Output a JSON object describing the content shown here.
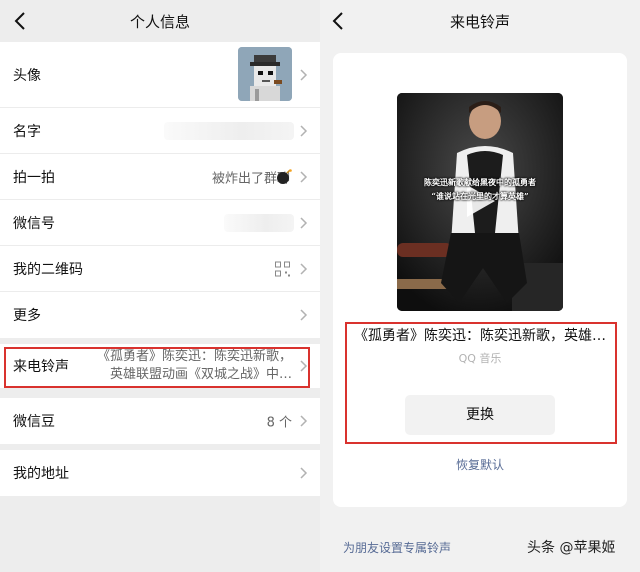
{
  "left": {
    "header": {
      "title": "个人信息"
    },
    "rows": {
      "avatar": {
        "label": "头像"
      },
      "name": {
        "label": "名字"
      },
      "pat": {
        "label": "拍一拍",
        "value": "被炸出了群聊"
      },
      "wechat_id": {
        "label": "微信号"
      },
      "qrcode": {
        "label": "我的二维码"
      },
      "more": {
        "label": "更多"
      },
      "ringtone": {
        "label": "来电铃声",
        "line1": "《孤勇者》陈奕迅：陈奕迅新歌，",
        "line2": "英雄联盟动画《双城之战》中…"
      },
      "beans": {
        "label": "微信豆",
        "value": "8 个"
      },
      "address": {
        "label": "我的地址"
      }
    }
  },
  "right": {
    "header": {
      "title": "来电铃声"
    },
    "video": {
      "caption_line1": "陈奕迅新歌献给黑夜中的孤勇者",
      "caption_line2": "“谁说站在光里的才算英雄”"
    },
    "song_title": "《孤勇者》陈奕迅：陈奕迅新歌，英雄…",
    "source": "QQ 音乐",
    "change_button": "更换",
    "restore_link": "恢复默认",
    "friend_link": "为朋友设置专属铃声",
    "watermark": "头条 @苹果姬"
  },
  "colors": {
    "highlight_box": "#d9322e",
    "link": "#576b95"
  }
}
